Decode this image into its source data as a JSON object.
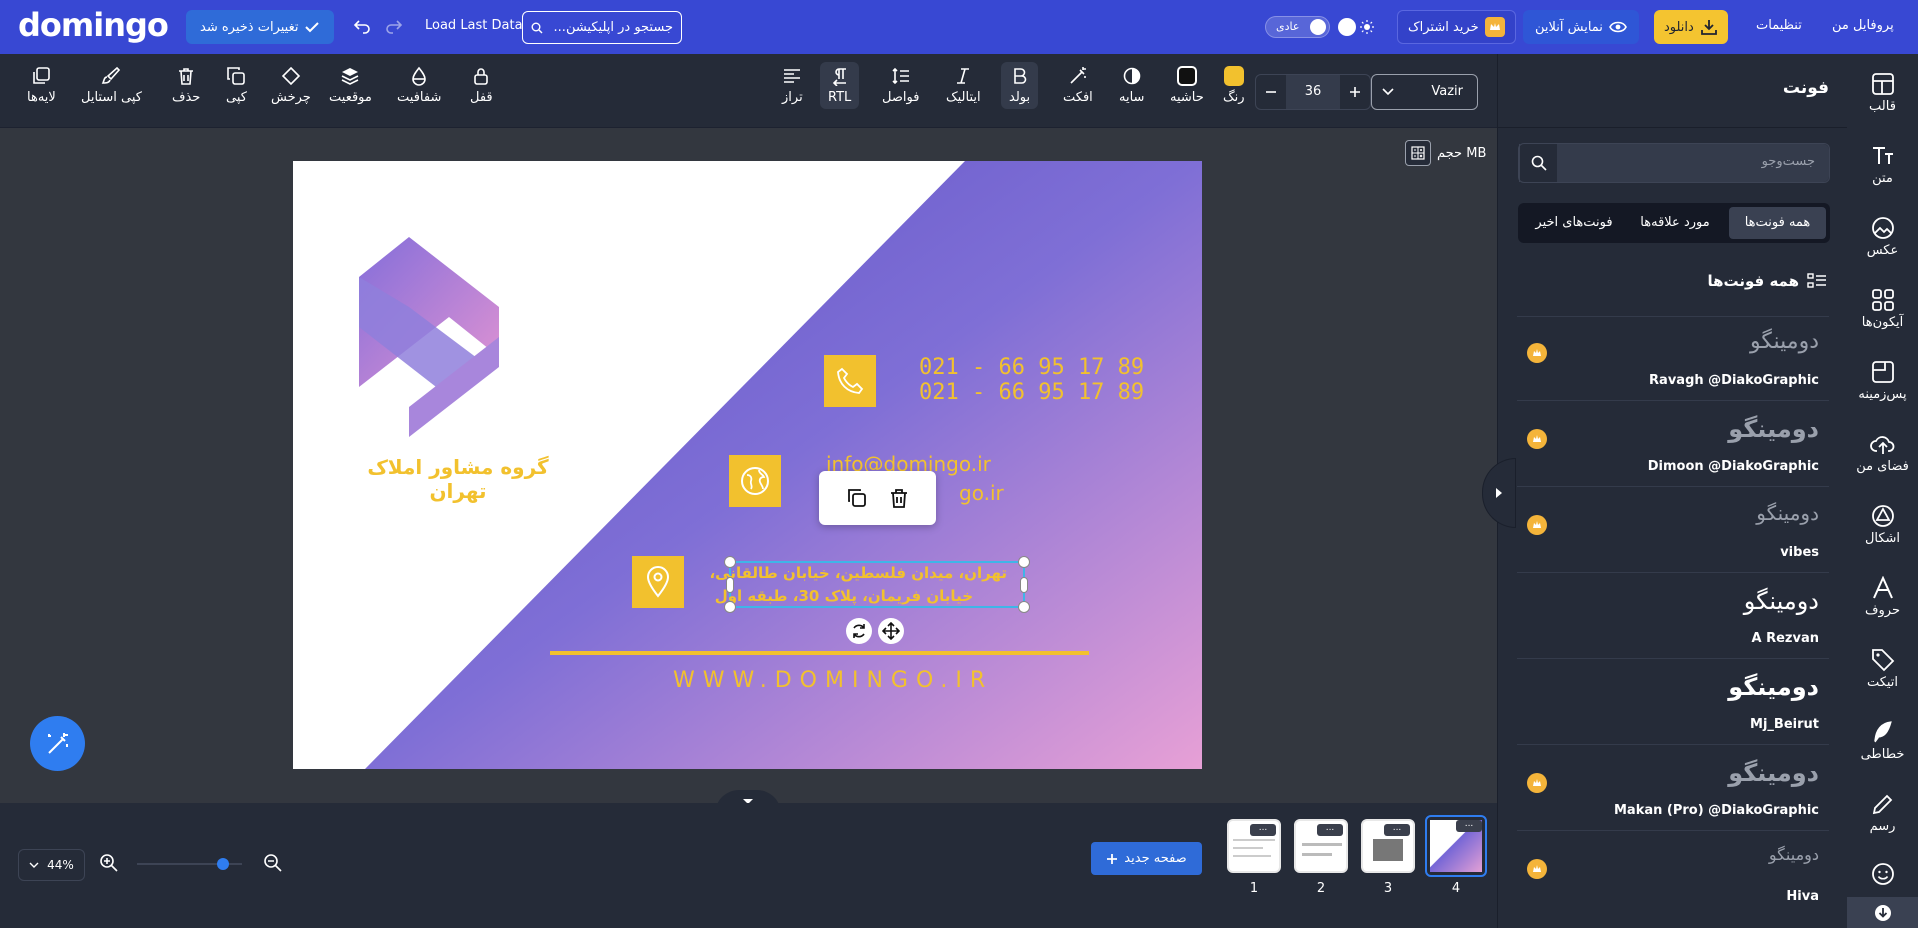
{
  "header": {
    "logo": "domingo",
    "save_status": "تغییرات ذخیره شد",
    "load_last": "Load Last Data",
    "search_placeholder": "جستجو در اپلیکیشن...",
    "mode_label": "عادی",
    "buy_sub": "خرید اشتراک",
    "online_preview": "نمایش آنلاین",
    "download": "دانلود",
    "settings": "تنظیمات",
    "profile": "پروفایل من"
  },
  "toolbar": {
    "layers": "لایه‌ها",
    "copy_style": "کپی استایل",
    "delete": "حذف",
    "copy": "کپی",
    "rotate": "چرخش",
    "position": "موقعیت",
    "opacity": "شفافیت",
    "lock": "قفل",
    "align": "تراز",
    "rtl": "RTL",
    "spacing": "فواصل",
    "italic": "ایتالیک",
    "bold": "بولد",
    "effect": "افکت",
    "shadow": "سایه",
    "border": "حاشیه",
    "color": "رنگ",
    "font_size": "36",
    "font_family": "Vazir",
    "text_color": "#f2c12e"
  },
  "canvas": {
    "size_label": "حجم MB",
    "company": "گروه مشاور املاک تهران",
    "phone1": "021 - 66 95 17 89",
    "phone2": "021 - 66 95 17 89",
    "email1": "info@domingo.ir",
    "email2": "go.ir",
    "address1": "تهران، میدان فلسطین، خیابان طالقانی،",
    "address2": "خیابان فریمان، پلاک 30، طبقه اول",
    "website": "WWW.DOMINGO.IR",
    "accent": "#f2c12e"
  },
  "panel": {
    "title": "فونت",
    "search_placeholder": "جست‌وجو",
    "tabs": [
      "همه فونت‌ها",
      "مورد علاقه‌ها",
      "فونت‌های اخیر"
    ],
    "section_title": "همه فونت‌ها",
    "fonts": [
      {
        "sample": "دومینگو",
        "name": "Ravagh @DiakoGraphic",
        "pro": true
      },
      {
        "sample": "دومینگو",
        "name": "Dimoon @DiakoGraphic",
        "pro": true
      },
      {
        "sample": "دومینگو",
        "name": "vibes",
        "pro": true
      },
      {
        "sample": "دومینگو",
        "name": "A Rezvan",
        "pro": false
      },
      {
        "sample": "دومینگو",
        "name": "Mj_Beirut",
        "pro": false
      },
      {
        "sample": "دومینگو",
        "name": "Makan (Pro) @DiakoGraphic",
        "pro": true
      },
      {
        "sample": "دومینگو",
        "name": "Hiva",
        "pro": true
      }
    ]
  },
  "iconbar": [
    "قالب",
    "متن",
    "عکس",
    "آیکون‌ها",
    "پس‌زمینه",
    "فضای من",
    "اشکال",
    "حروف",
    "اتیکت",
    "خطاطی",
    "رسم"
  ],
  "bottom": {
    "new_page": "صفحه جدید",
    "zoom": "44%",
    "zoom_fill": 0.82,
    "pages": [
      "1",
      "2",
      "3",
      "4"
    ],
    "thumb_menu": "..."
  }
}
